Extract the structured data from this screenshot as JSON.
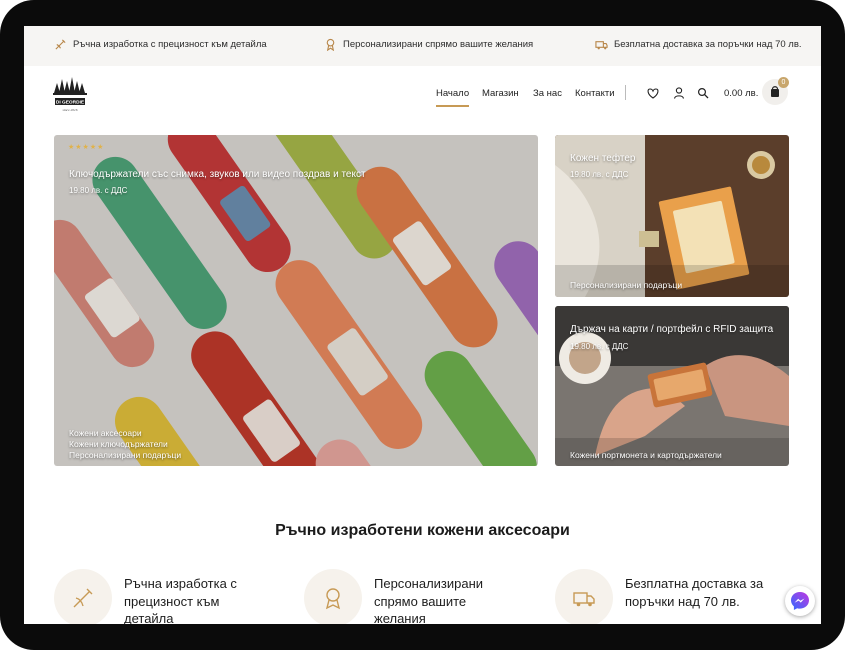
{
  "topbar": {
    "item1": "Ръчна изработка с прецизност към детайла",
    "item2": "Персонализирани спрямо вашите желания",
    "item3": "Безплатна доставка за поръчки над 70 лв."
  },
  "logo": {
    "line1": "DI GEORDIE",
    "line2": "since 2016"
  },
  "nav": [
    {
      "label": "Начало",
      "active": true
    },
    {
      "label": "Магазин"
    },
    {
      "label": "За нас"
    },
    {
      "label": "Контакти"
    }
  ],
  "header_icons": [
    "heart-icon",
    "user-icon",
    "search-icon",
    "bag-icon"
  ],
  "cart": {
    "total": "0.00 лв.",
    "count": "0"
  },
  "cards": [
    {
      "title": "Ключодържатели със снимка, звуков или видео поздрав и текст",
      "price": "19.80 лв. с ДДС",
      "stars": "★★★★★",
      "categories": [
        "Кожени аксесоари",
        "Кожени ключодържатели",
        "Персонализирани подаръци"
      ]
    },
    {
      "title": "Кожен тефтер",
      "price": "19.80 лв. с ДДС",
      "categories": [
        "Персонализирани подаръци"
      ]
    },
    {
      "title": "Държач на карти / портфейл с RFID защита",
      "price": "19.80 лв. с ДДС",
      "categories": [
        "Кожени портмонета и картодържатели"
      ]
    }
  ],
  "section": {
    "title": "Ръчно изработени кожени аксесоари"
  },
  "features": [
    {
      "text": "Ръчна изработка с прецизност към детайла",
      "icon": "needle-icon"
    },
    {
      "text": "Персонализирани спрямо вашите желания",
      "icon": "award-ribbon-icon"
    },
    {
      "text": "Безплатна доставка за поръчки над 70 лв.",
      "icon": "delivery-truck-icon"
    }
  ],
  "colors": {
    "accent": "#c79a55",
    "topbar_bg": "#f6f5f3",
    "feature_bg": "#f6f2ec"
  }
}
